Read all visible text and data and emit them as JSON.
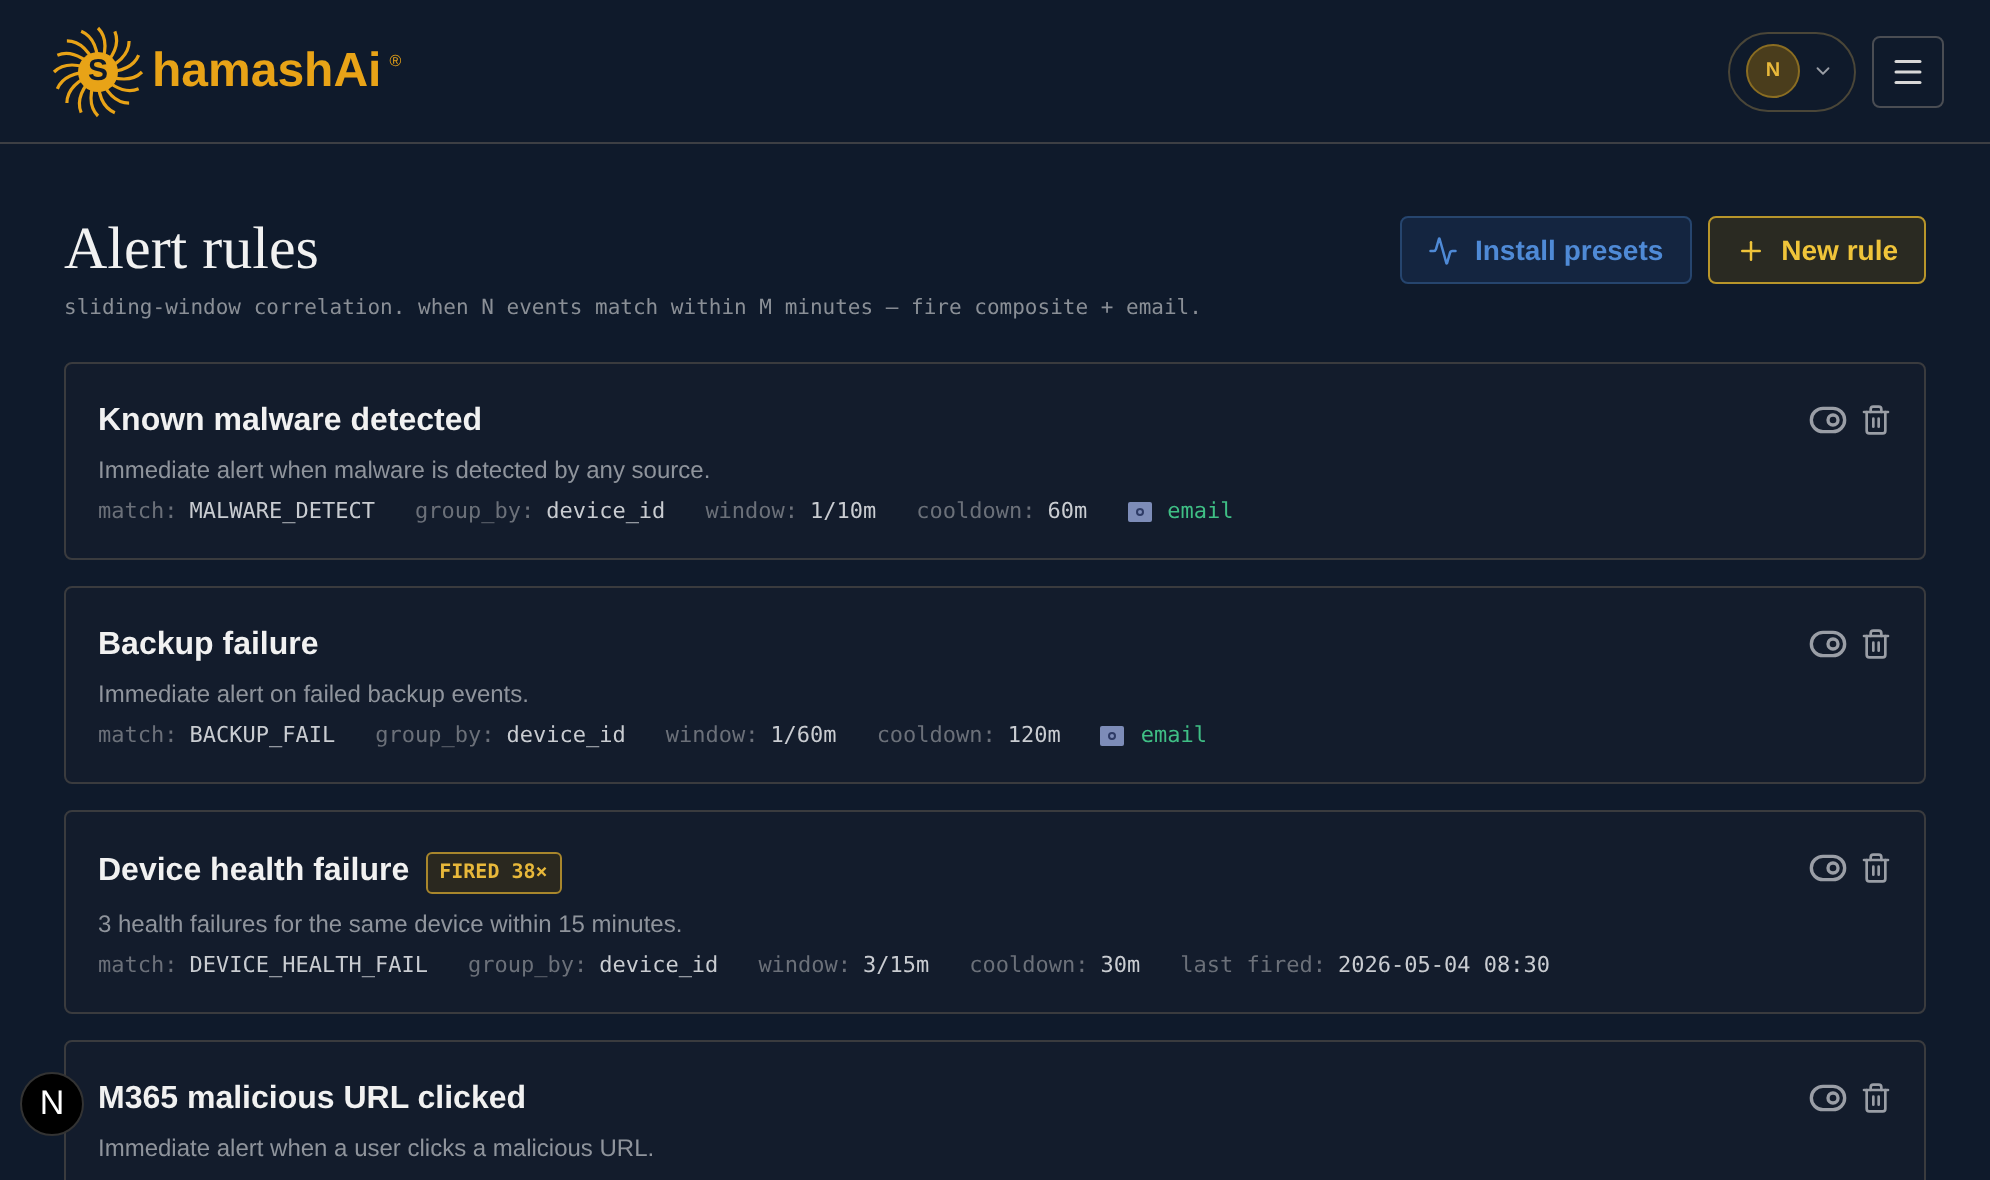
{
  "header": {
    "logo_mark": "S",
    "brand": "hamashAi",
    "registered": "®",
    "avatar": "N"
  },
  "page": {
    "title": "Alert rules",
    "subtitle": "sliding-window correlation. when N events match within M minutes — fire composite + email.",
    "buttons": [
      {
        "kind": "secondary",
        "label": "Install presets"
      },
      {
        "kind": "primary",
        "label": "New rule"
      }
    ]
  },
  "rules": [
    {
      "name": "Known malware detected",
      "description": "Immediate alert when malware is detected by any source.",
      "meta": [
        {
          "label": "match:",
          "value": "MALWARE_DETECT"
        },
        {
          "label": "group_by:",
          "value": "device_id"
        },
        {
          "label": "window:",
          "value": "1/10m"
        },
        {
          "label": "cooldown:",
          "value": "60m"
        }
      ],
      "channel": "email"
    },
    {
      "name": "Backup failure",
      "description": "Immediate alert on failed backup events.",
      "meta": [
        {
          "label": "match:",
          "value": "BACKUP_FAIL"
        },
        {
          "label": "group_by:",
          "value": "device_id"
        },
        {
          "label": "window:",
          "value": "1/60m"
        },
        {
          "label": "cooldown:",
          "value": "120m"
        }
      ],
      "channel": "email"
    },
    {
      "name": "Device health failure",
      "badge": "FIRED 38×",
      "description": "3 health failures for the same device within 15 minutes.",
      "meta": [
        {
          "label": "match:",
          "value": "DEVICE_HEALTH_FAIL"
        },
        {
          "label": "group_by:",
          "value": "device_id"
        },
        {
          "label": "window:",
          "value": "3/15m"
        },
        {
          "label": "cooldown:",
          "value": "30m"
        },
        {
          "label": "last fired:",
          "value": "2026-05-04 08:30"
        }
      ]
    },
    {
      "name": "M365 malicious URL clicked",
      "description": "Immediate alert when a user clicks a malicious URL."
    }
  ],
  "floating_badge": "N"
}
